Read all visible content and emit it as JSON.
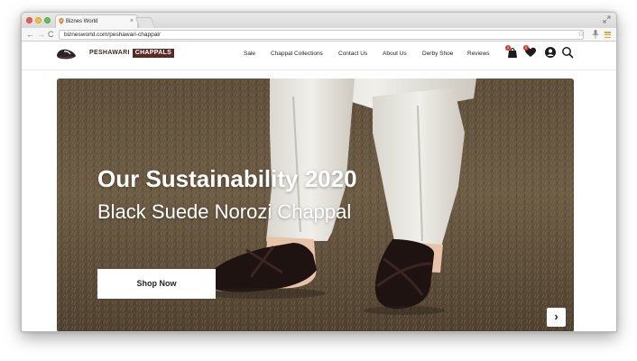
{
  "browser": {
    "tab_title": "Biznes World",
    "url": "biznesworld.com/peshawari-chappal/",
    "tab_close": "×",
    "back_glyph": "←",
    "forward_glyph": "→",
    "reload_glyph": "C",
    "star_glyph": "☆"
  },
  "site": {
    "logo": {
      "peshawari": "PESHAWARI",
      "chappals": "CHAPPALS"
    },
    "nav": [
      "Sale",
      "Chappal Collections",
      "Contact Us",
      "About Us",
      "Derby Shoe",
      "Reviews"
    ],
    "icons": [
      "bag-icon",
      "heart-icon",
      "account-icon",
      "search-icon"
    ],
    "badges": {
      "bag": "0",
      "wishlist": "0"
    }
  },
  "hero": {
    "title": "Our Sustainability 2020",
    "subtitle": "Black Suede Norozi Chappal",
    "cta_label": "Shop Now",
    "next_glyph": "›"
  },
  "colors": {
    "brand": "#5a2a24",
    "traffic_close": "#ef5b52",
    "traffic_min": "#f5bd3f",
    "traffic_max": "#5fc553",
    "menu_accent": "#f0a020"
  }
}
